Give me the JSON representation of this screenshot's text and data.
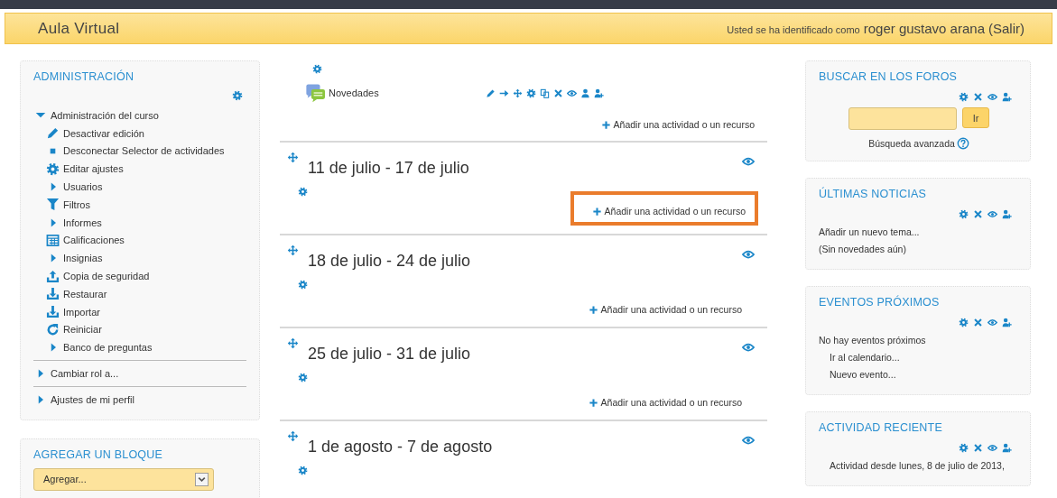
{
  "header": {
    "site_title": "Aula Virtual",
    "login_prefix": "Usted se ha identificado como",
    "user_name": "roger gustavo arana",
    "logout": "(Salir)"
  },
  "left_blocks": {
    "admin": {
      "title": "ADMINISTRACIÓN",
      "items": [
        {
          "label": "Administración del curso",
          "kind": "node",
          "expanded": true,
          "children": [
            {
              "label": "Desactivar edición",
              "kind": "edit"
            },
            {
              "label": "Desconectar Selector de actividades",
              "kind": "bullet"
            },
            {
              "label": "Editar ajustes",
              "kind": "settings"
            },
            {
              "label": "Usuarios",
              "kind": "node",
              "expanded": false
            },
            {
              "label": "Filtros",
              "kind": "filter"
            },
            {
              "label": "Informes",
              "kind": "node",
              "expanded": false
            },
            {
              "label": "Calificaciones",
              "kind": "grades"
            },
            {
              "label": "Insignias",
              "kind": "node",
              "expanded": false
            },
            {
              "label": "Copia de seguridad",
              "kind": "backup"
            },
            {
              "label": "Restaurar",
              "kind": "restore"
            },
            {
              "label": "Importar",
              "kind": "import"
            },
            {
              "label": "Reiniciar",
              "kind": "reset"
            },
            {
              "label": "Banco de preguntas",
              "kind": "node",
              "expanded": false
            }
          ]
        },
        {
          "label": "Cambiar rol a...",
          "kind": "node",
          "expanded": false
        },
        {
          "label": "Ajustes de mi perfil",
          "kind": "node",
          "expanded": false
        }
      ]
    },
    "add_block": {
      "title": "AGREGAR UN BLOQUE",
      "select_value": "Agregar..."
    }
  },
  "course": {
    "intro": {
      "activity": "Novedades",
      "add_link": "Añadir una actividad o un recurso"
    },
    "sections": [
      {
        "title": "11 de julio - 17 de julio",
        "add_link": "Añadir una actividad o un recurso",
        "highlighted": true
      },
      {
        "title": "18 de julio - 24 de julio",
        "add_link": "Añadir una actividad o un recurso",
        "highlighted": false
      },
      {
        "title": "25 de julio - 31 de julio",
        "add_link": "Añadir una actividad o un recurso",
        "highlighted": false
      },
      {
        "title": "1 de agosto - 7 de agosto",
        "highlighted": false
      }
    ]
  },
  "right_blocks": [
    {
      "kind": "search",
      "title": "BUSCAR EN LOS FOROS",
      "button": "Ir",
      "advanced_link": "Búsqueda avanzada"
    },
    {
      "kind": "list",
      "title": "ÚLTIMAS NOTICIAS",
      "lines": [
        {
          "text": "Añadir un nuevo tema...",
          "kind": "plain"
        },
        {
          "text": "(Sin novedades aún)",
          "kind": "plain"
        }
      ]
    },
    {
      "kind": "list",
      "title": "EVENTOS PRÓXIMOS",
      "lines": [
        {
          "text": "No hay eventos próximos",
          "kind": "plain"
        },
        {
          "text": "Ir al calendario...",
          "kind": "indented"
        },
        {
          "text": "Nuevo evento...",
          "kind": "indented"
        }
      ]
    },
    {
      "kind": "list",
      "title": "ACTIVIDAD RECIENTE",
      "lines": [
        {
          "text": "Actividad desde lunes, 8 de julio de 2013,",
          "kind": "indented"
        }
      ]
    }
  ]
}
